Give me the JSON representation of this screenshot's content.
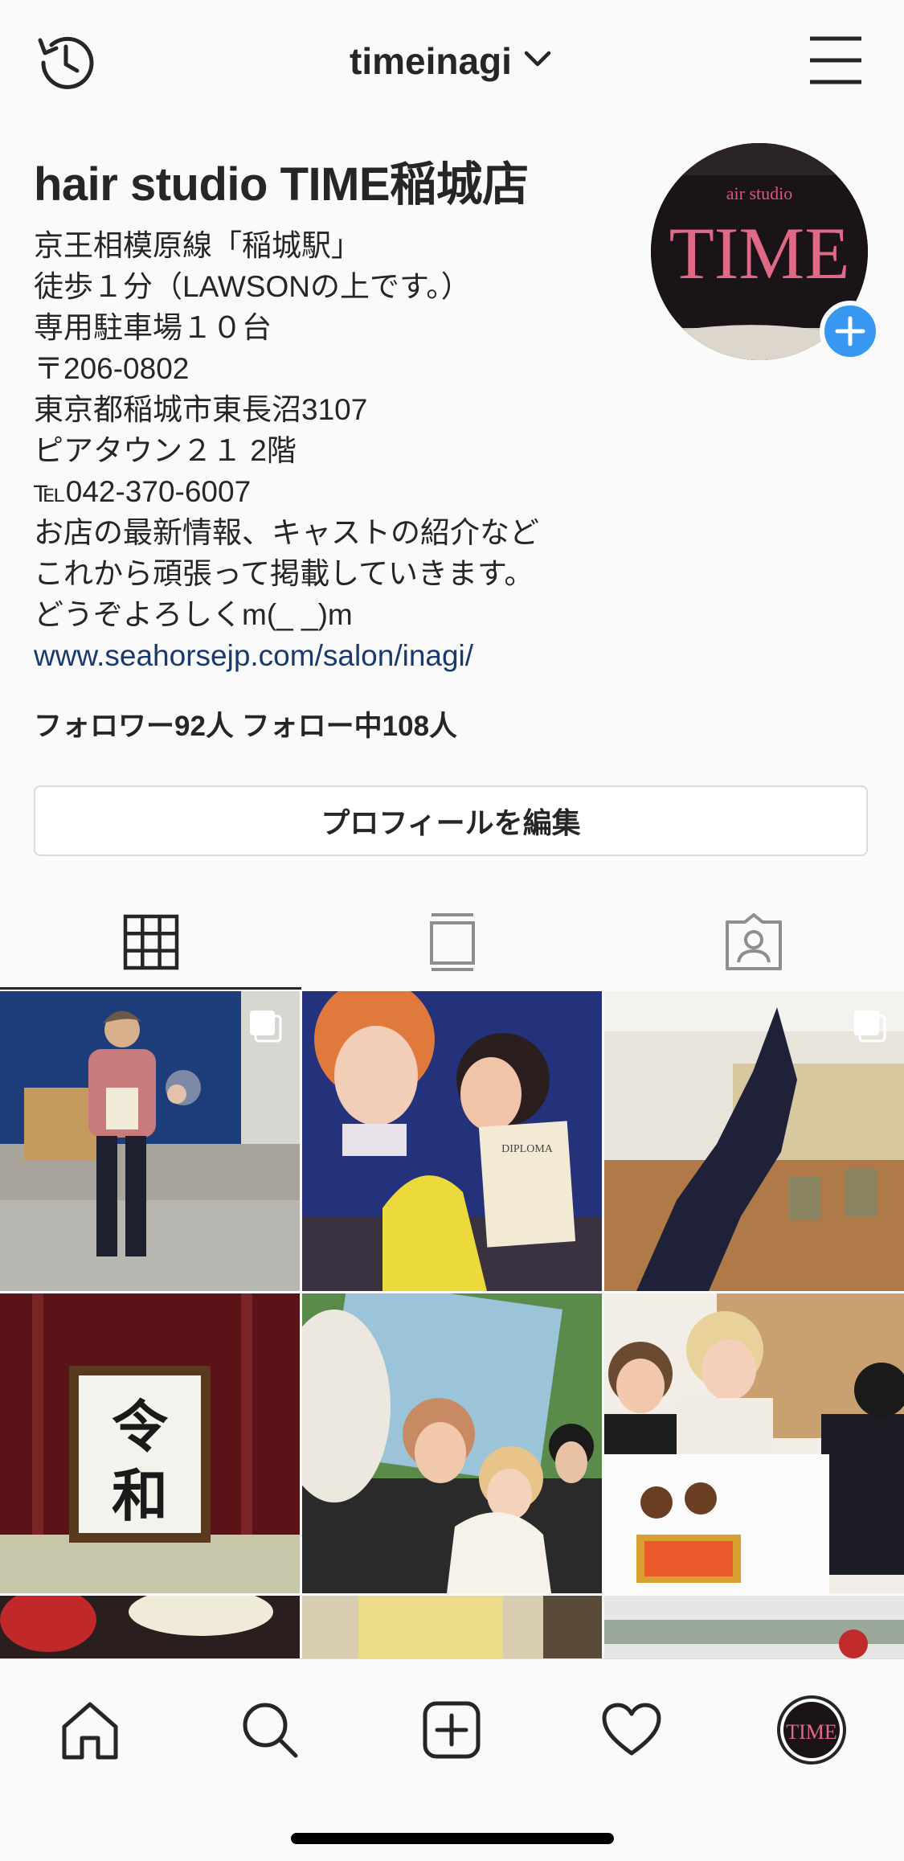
{
  "header": {
    "username": "timeinagi"
  },
  "profile": {
    "display_name": "hair studio TIME稲城店",
    "bio_lines": [
      "京王相模原線「稲城駅」",
      "徒歩１分（LAWSONの上です。）",
      "専用駐車場１０台",
      "〒206-0802",
      "東京都稲城市東長沼3107",
      "ピアタウン２１ 2階",
      "℡042-370-6007",
      "お店の最新情報、キャストの紹介など",
      "これから頑張って掲載していきます。",
      "どうぞよろしくm(_ _)m"
    ],
    "link": "www.seahorsejp.com/salon/inagi/",
    "stats": "フォロワー92人  フォロー中108人",
    "edit_button": "プロフィールを編集",
    "avatar_text": "TIME",
    "avatar_subtext": "air studio"
  },
  "grid": {
    "reiwa_top": "令",
    "reiwa_bottom": "和",
    "diploma": "DIPLOMA"
  },
  "colors": {
    "link": "#1a3a6e",
    "accent_blue": "#3897f0",
    "text": "#262626",
    "border": "#dbdbdb"
  },
  "icons": [
    "history-icon",
    "chevron-down-icon",
    "menu-icon",
    "grid-icon",
    "feed-icon",
    "tagged-icon",
    "home-icon",
    "search-icon",
    "add-post-icon",
    "heart-icon",
    "profile-avatar-icon"
  ]
}
